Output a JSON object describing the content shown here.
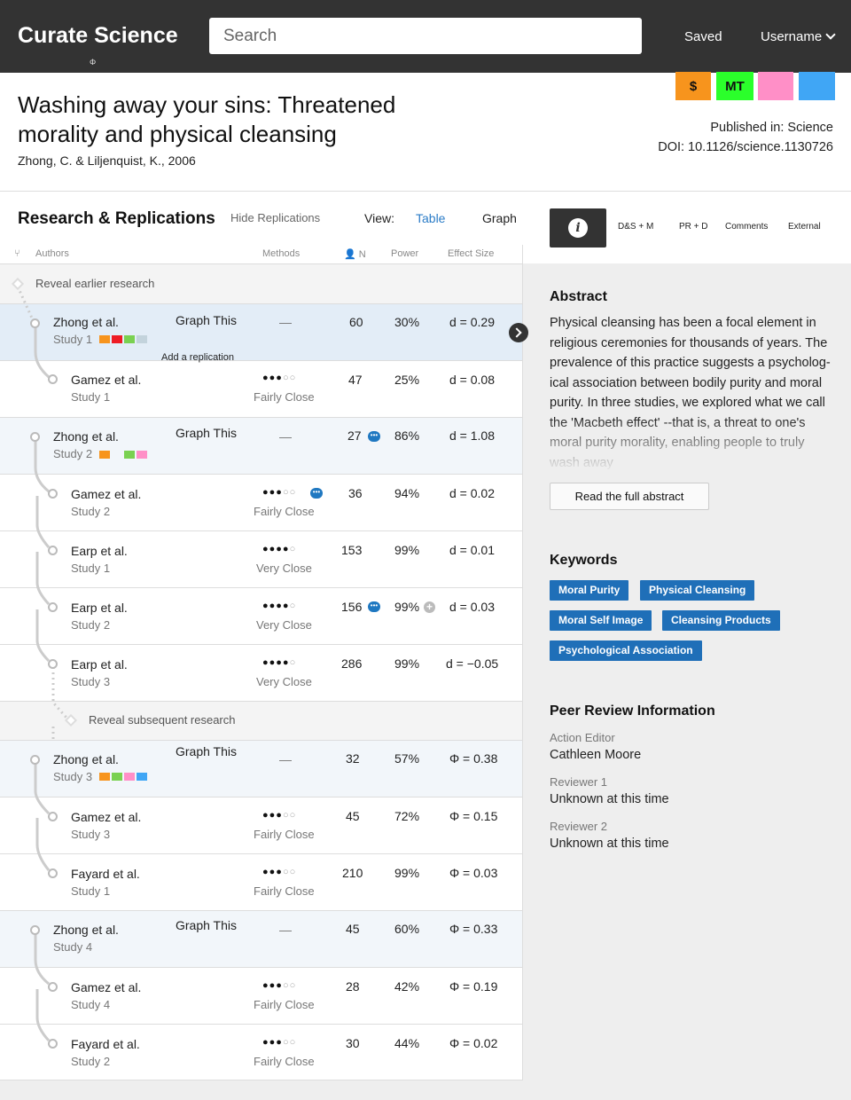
{
  "nav": {
    "brand": "Curate Science",
    "brand_sub": "Φ",
    "search_placeholder": "Search",
    "saved": "Saved",
    "username": "Username"
  },
  "badges": [
    {
      "label": "$",
      "color": "#f7941d"
    },
    {
      "label": "MT",
      "color": "#2bff2b"
    },
    {
      "label": "",
      "color": "#ff8fc7"
    },
    {
      "label": "",
      "color": "#40a6f5"
    }
  ],
  "paper": {
    "title": "Washing away your sins: Threatened morality and physical cleansing",
    "authors": "Zhong, C. & Liljenquist, K., 2006",
    "published": "Published in: Science",
    "doi": "DOI: 10.1126/science.1130726"
  },
  "section": {
    "title": "Research & Replications",
    "hide": "Hide Replications",
    "view_label": "View:",
    "view_table": "Table",
    "view_graph": "Graph"
  },
  "right_tabs": [
    "D&S + M",
    "PR + D",
    "Comments",
    "External"
  ],
  "columns": {
    "authors": "Authors",
    "methods": "Methods",
    "n": "N",
    "power": "Power",
    "effect": "Effect Size"
  },
  "reveal_earlier": "Reveal earlier research",
  "reveal_subsequent": "Reveal subsequent research",
  "graph_this": "Graph This",
  "add_replication": "Add a replication",
  "dash": "—",
  "rows": [
    {
      "author": "Zhong et al.",
      "study": "Study 1",
      "n": "60",
      "power": "30%",
      "effect": "d = 0.29"
    },
    {
      "author": "Gamez et al.",
      "study": "Study 1",
      "method": "Fairly Close",
      "n": "47",
      "power": "25%",
      "effect": "d = 0.08"
    },
    {
      "author": "Zhong et al.",
      "study": "Study 2",
      "n": "27",
      "power": "86%",
      "effect": "d = 1.08"
    },
    {
      "author": "Gamez et al.",
      "study": "Study 2",
      "method": "Fairly Close",
      "n": "36",
      "power": "94%",
      "effect": "d = 0.02"
    },
    {
      "author": "Earp et al.",
      "study": "Study 1",
      "method": "Very Close",
      "n": "153",
      "power": "99%",
      "effect": "d = 0.01"
    },
    {
      "author": "Earp et al.",
      "study": "Study 2",
      "method": "Very Close",
      "n": "156",
      "power": "99%",
      "effect": "d = 0.03"
    },
    {
      "author": "Earp et al.",
      "study": "Study 3",
      "method": "Very Close",
      "n": "286",
      "power": "99%",
      "effect": "d = −0.05"
    },
    {
      "author": "Zhong et al.",
      "study": "Study 3",
      "n": "32",
      "power": "57%",
      "effect": "Φ = 0.38"
    },
    {
      "author": "Gamez et al.",
      "study": "Study 3",
      "method": "Fairly Close",
      "n": "45",
      "power": "72%",
      "effect": "Φ = 0.15"
    },
    {
      "author": "Fayard et al.",
      "study": "Study 1",
      "method": "Fairly Close",
      "n": "210",
      "power": "99%",
      "effect": "Φ = 0.03"
    },
    {
      "author": "Zhong et al.",
      "study": "Study 4",
      "n": "45",
      "power": "60%",
      "effect": "Φ = 0.33"
    },
    {
      "author": "Gamez et al.",
      "study": "Study 4",
      "method": "Fairly Close",
      "n": "28",
      "power": "42%",
      "effect": "Φ = 0.19"
    },
    {
      "author": "Fayard et al.",
      "study": "Study 2",
      "method": "Fairly Close",
      "n": "30",
      "power": "44%",
      "effect": "Φ = 0.02"
    }
  ],
  "abstract": {
    "heading": "Abstract",
    "text": "Physical cleansing has been a focal element in religious ceremonies for thousands of years. The prevalence of this practice suggests a psycholog-ical association between bodily purity and moral purity. In three studies, we explored what we call the 'Macbeth effect' --that is, a threat to one's moral purity morality, enabling people to truly wash away",
    "button": "Read the full abstract"
  },
  "keywords": {
    "heading": "Keywords",
    "items": [
      "Moral Purity",
      "Physical Cleansing",
      "Moral Self Image",
      "Cleansing Products",
      "Psychological Association"
    ]
  },
  "peer_review": {
    "heading": "Peer Review Information",
    "action_editor_label": "Action Editor",
    "action_editor": "Cathleen Moore",
    "reviewer1_label": "Reviewer 1",
    "reviewer1": "Unknown at this time",
    "reviewer2_label": "Reviewer 2",
    "reviewer2": "Unknown at this time"
  }
}
